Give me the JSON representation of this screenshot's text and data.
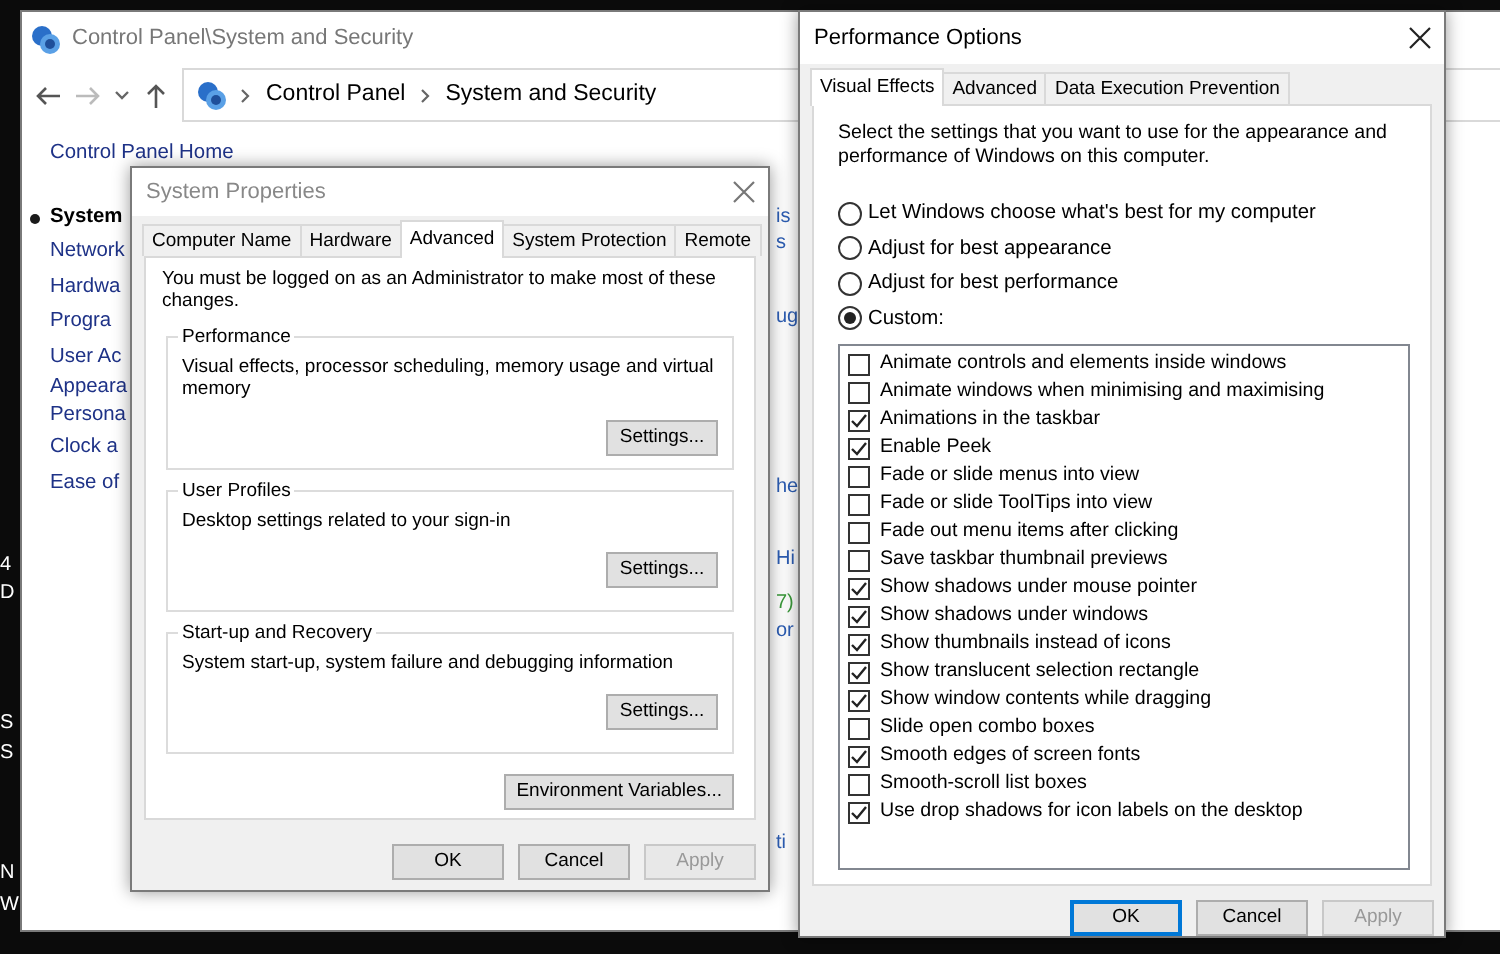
{
  "desktop_fragments": [
    "4",
    "D",
    "S",
    "S",
    "N",
    "W"
  ],
  "control_panel": {
    "title": "Control Panel\\System and Security",
    "breadcrumbs": [
      "Control Panel",
      "System and Security"
    ],
    "sidebar": {
      "home": "Control Panel Home",
      "items": [
        {
          "label": "System",
          "selected": true
        },
        {
          "label": "Network",
          "selected": false
        },
        {
          "label": "Hardwa",
          "selected": false
        },
        {
          "label": "Progra",
          "selected": false
        },
        {
          "label": "User Ac",
          "selected": false
        },
        {
          "label": "Appeara",
          "selected": false
        },
        {
          "label": "Persona",
          "selected": false
        },
        {
          "label": "Clock a",
          "selected": false
        },
        {
          "label": "Ease of",
          "selected": false
        }
      ]
    },
    "content_fragments": [
      {
        "text": "is",
        "kind": "link"
      },
      {
        "text": "s",
        "kind": "link"
      },
      {
        "text": "ug",
        "kind": "link"
      },
      {
        "text": "he",
        "kind": "link"
      },
      {
        "text": "Hi",
        "kind": "link"
      },
      {
        "text": "7)",
        "kind": "green"
      },
      {
        "text": "or",
        "kind": "link"
      },
      {
        "text": "ti",
        "kind": "link"
      }
    ]
  },
  "system_properties": {
    "title": "System Properties",
    "tabs": [
      {
        "label": "Computer Name",
        "selected": false
      },
      {
        "label": "Hardware",
        "selected": false
      },
      {
        "label": "Advanced",
        "selected": true
      },
      {
        "label": "System Protection",
        "selected": false
      },
      {
        "label": "Remote",
        "selected": false
      }
    ],
    "notice": "You must be logged on as an Administrator to make most of these changes.",
    "groups": [
      {
        "title": "Performance",
        "description": "Visual effects, processor scheduling, memory usage and virtual memory",
        "button": "Settings..."
      },
      {
        "title": "User Profiles",
        "description": "Desktop settings related to your sign-in",
        "button": "Settings..."
      },
      {
        "title": "Start-up and Recovery",
        "description": "System start-up, system failure and debugging information",
        "button": "Settings..."
      }
    ],
    "env_button": "Environment Variables...",
    "buttons": [
      {
        "label": "OK",
        "disabled": false
      },
      {
        "label": "Cancel",
        "disabled": false
      },
      {
        "label": "Apply",
        "disabled": true
      }
    ]
  },
  "performance_options": {
    "title": "Performance Options",
    "tabs": [
      {
        "label": "Visual Effects",
        "selected": true
      },
      {
        "label": "Advanced",
        "selected": false
      },
      {
        "label": "Data Execution Prevention",
        "selected": false
      }
    ],
    "description": "Select the settings that you want to use for the appearance and performance of Windows on this computer.",
    "options": [
      {
        "label": "Let Windows choose what's best for my computer",
        "selected": false
      },
      {
        "label": "Adjust for best appearance",
        "selected": false
      },
      {
        "label": "Adjust for best performance",
        "selected": false
      },
      {
        "label": "Custom:",
        "selected": true
      }
    ],
    "effects": [
      {
        "label": "Animate controls and elements inside windows",
        "checked": false
      },
      {
        "label": "Animate windows when minimising and maximising",
        "checked": false
      },
      {
        "label": "Animations in the taskbar",
        "checked": true
      },
      {
        "label": "Enable Peek",
        "checked": true
      },
      {
        "label": "Fade or slide menus into view",
        "checked": false
      },
      {
        "label": "Fade or slide ToolTips into view",
        "checked": false
      },
      {
        "label": "Fade out menu items after clicking",
        "checked": false
      },
      {
        "label": "Save taskbar thumbnail previews",
        "checked": false
      },
      {
        "label": "Show shadows under mouse pointer",
        "checked": true
      },
      {
        "label": "Show shadows under windows",
        "checked": true
      },
      {
        "label": "Show thumbnails instead of icons",
        "checked": true
      },
      {
        "label": "Show translucent selection rectangle",
        "checked": true
      },
      {
        "label": "Show window contents while dragging",
        "checked": true
      },
      {
        "label": "Slide open combo boxes",
        "checked": false
      },
      {
        "label": "Smooth edges of screen fonts",
        "checked": true
      },
      {
        "label": "Smooth-scroll list boxes",
        "checked": false
      },
      {
        "label": "Use drop shadows for icon labels on the desktop",
        "checked": true
      }
    ],
    "buttons": [
      {
        "label": "OK",
        "disabled": false,
        "default": true
      },
      {
        "label": "Cancel",
        "disabled": false,
        "default": false
      },
      {
        "label": "Apply",
        "disabled": true,
        "default": false
      }
    ]
  }
}
